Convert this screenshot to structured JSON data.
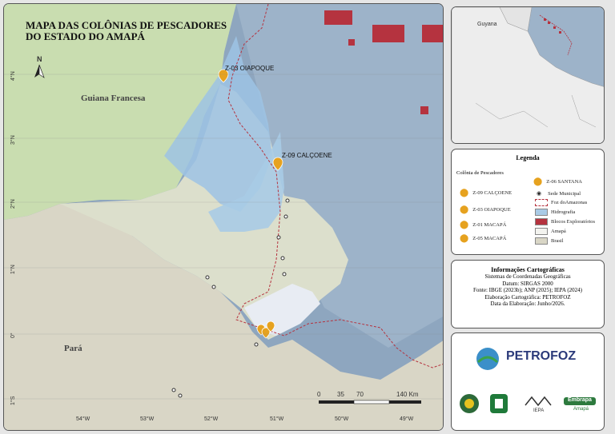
{
  "map": {
    "title_line1": "MAPA DAS COLÔNIAS DE PESCADORES",
    "title_line2": "DO ESTADO DO AMAPÁ",
    "north_label": "N",
    "regions": {
      "guiana": "Guiana Francesa",
      "para": "Pará"
    },
    "colonies": {
      "oiapoque": "Z-03 OIAPOQUE",
      "calcoene": "Z-09 CALÇOENE"
    },
    "lon_ticks": [
      "54°W",
      "53°W",
      "52°W",
      "51°W",
      "50°W",
      "49°W"
    ],
    "lat_ticks": [
      "4°N",
      "3°N",
      "2°N",
      "1°N",
      "0°",
      "1°S"
    ],
    "scale": {
      "t0": "0",
      "t1": "35",
      "t2": "70",
      "t3": "140 Km"
    }
  },
  "inset": {
    "country_label": "Guyana"
  },
  "legend": {
    "title": "Legenda",
    "subtitle": "Colônia de Pescadores",
    "items": {
      "calcoene": "Z-09 CALÇOENE",
      "oiapoque": "Z-03 OIAPOQUE",
      "macapa1": "Z-01 MACAPÁ",
      "macapa5": "Z-05 MACAPÁ",
      "santana": "Z-06 SANTANA",
      "sede": "Sede Municipal",
      "foz": "Foz doAmazonas",
      "hidro": "Hidrografia",
      "blocos": "Blocos Exploratórios",
      "amapa": "Amapá",
      "brasil": "Brasil"
    },
    "colors": {
      "hidro": "#a9cbe6",
      "blocos": "#b5333f",
      "amapa": "#f3f3ef",
      "brasil": "#d9d6c6",
      "marker": "#e6a21f"
    }
  },
  "info": {
    "title": "Informações Cartográficas",
    "lines": [
      "Sistemas de Coordenadas Geográficas",
      "Datum: SIRGAS 2000",
      "Fonte: IBGE (2023b); ANP (2025); IEPA (2024)",
      "Elaboração Cartográfica: PETROFOZ",
      "Data da Elaboração: Junho/2026."
    ]
  },
  "logos": {
    "petrofoz": "PETROFOZ",
    "iepa": "IEPA",
    "embrapa": "Embrapa",
    "embrapa_sub": "Amapá"
  }
}
